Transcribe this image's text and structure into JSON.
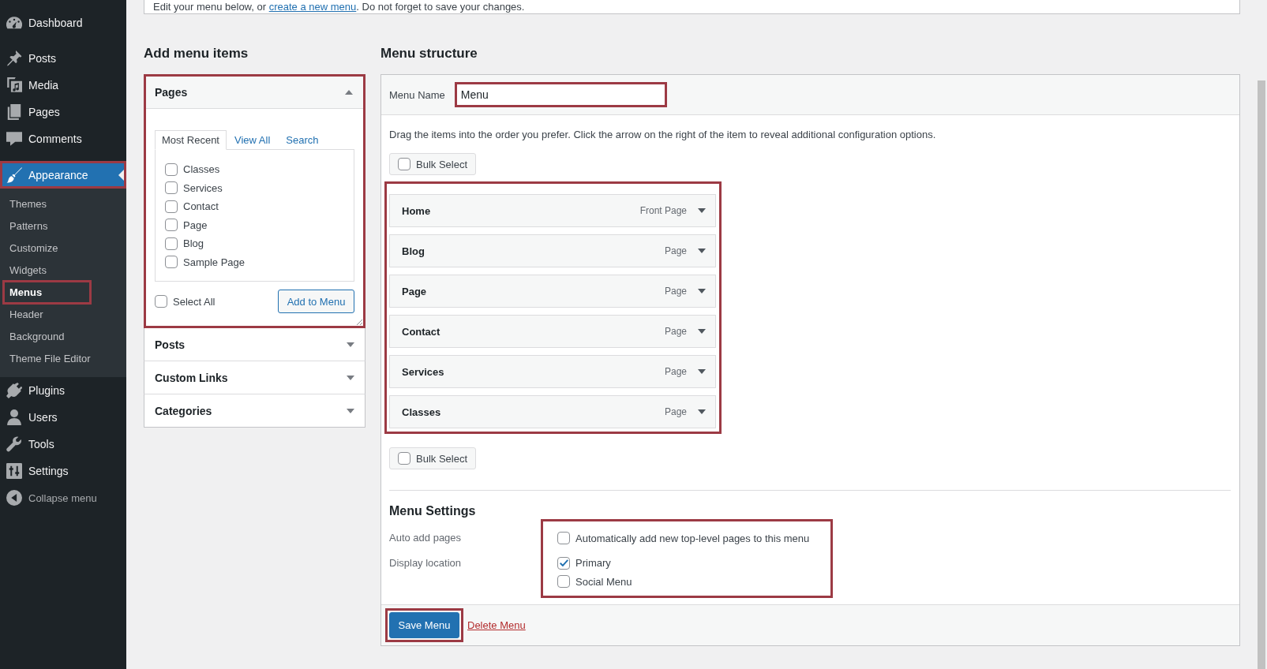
{
  "sidebar": {
    "groups": [
      [
        {
          "label": "Dashboard",
          "current": false,
          "highlighted": false
        }
      ],
      [
        {
          "label": "Posts",
          "current": false,
          "highlighted": false
        },
        {
          "label": "Media",
          "current": false,
          "highlighted": false
        },
        {
          "label": "Pages",
          "current": false,
          "highlighted": false
        },
        {
          "label": "Comments",
          "current": false,
          "highlighted": false
        }
      ],
      [
        {
          "label": "Appearance",
          "current": true,
          "highlighted": true,
          "submenu": [
            {
              "label": "Themes",
              "selected": false,
              "highlighted": false
            },
            {
              "label": "Patterns",
              "selected": false,
              "highlighted": false
            },
            {
              "label": "Customize",
              "selected": false,
              "highlighted": false
            },
            {
              "label": "Widgets",
              "selected": false,
              "highlighted": false
            },
            {
              "label": "Menus",
              "selected": true,
              "highlighted": true
            },
            {
              "label": "Header",
              "selected": false,
              "highlighted": false
            },
            {
              "label": "Background",
              "selected": false,
              "highlighted": false
            },
            {
              "label": "Theme File Editor",
              "selected": false,
              "highlighted": false
            }
          ]
        },
        {
          "label": "Plugins",
          "current": false,
          "highlighted": false
        },
        {
          "label": "Users",
          "current": false,
          "highlighted": false
        },
        {
          "label": "Tools",
          "current": false,
          "highlighted": false
        },
        {
          "label": "Settings",
          "current": false,
          "highlighted": false
        }
      ]
    ],
    "collapse_label": "Collapse menu"
  },
  "notice": {
    "text_before": "Edit your menu below, or ",
    "link": "create a new menu",
    "text_after": ". Do not forget to save your changes."
  },
  "add_menu_items": {
    "title": "Add menu items",
    "sections": [
      {
        "title": "Pages",
        "expanded": true,
        "highlighted": true,
        "tabs": [
          {
            "label": "Most Recent",
            "selected": true
          },
          {
            "label": "View All",
            "selected": false
          },
          {
            "label": "Search",
            "selected": false
          }
        ],
        "items": [
          {
            "label": "Classes",
            "checked": false
          },
          {
            "label": "Services",
            "checked": false
          },
          {
            "label": "Contact",
            "checked": false
          },
          {
            "label": "Page",
            "checked": false
          },
          {
            "label": "Blog",
            "checked": false
          },
          {
            "label": "Sample Page",
            "checked": false
          }
        ],
        "select_all": {
          "label": "Select All",
          "checked": false
        },
        "button": "Add to Menu"
      },
      {
        "title": "Posts",
        "expanded": false,
        "highlighted": false
      },
      {
        "title": "Custom Links",
        "expanded": false,
        "highlighted": false
      },
      {
        "title": "Categories",
        "expanded": false,
        "highlighted": false
      }
    ]
  },
  "menu_structure": {
    "title": "Menu structure",
    "menu_name": {
      "label": "Menu Name",
      "value": "Menu",
      "highlighted": true
    },
    "instructions": "Drag the items into the order you prefer. Click the arrow on the right of the item to reveal additional configuration options.",
    "bulk_select_top": {
      "label": "Bulk Select",
      "checked": false
    },
    "menu_items": {
      "highlighted": true,
      "items": [
        {
          "title": "Home",
          "type": "Front Page"
        },
        {
          "title": "Blog",
          "type": "Page"
        },
        {
          "title": "Page",
          "type": "Page"
        },
        {
          "title": "Contact",
          "type": "Page"
        },
        {
          "title": "Services",
          "type": "Page"
        },
        {
          "title": "Classes",
          "type": "Page"
        }
      ]
    },
    "bulk_select_bottom": {
      "label": "Bulk Select",
      "checked": false
    },
    "settings": {
      "title": "Menu Settings",
      "highlighted": true,
      "auto_add": {
        "label": "Auto add pages",
        "option": {
          "label": "Automatically add new top-level pages to this menu",
          "checked": false
        }
      },
      "display_location": {
        "label": "Display location",
        "options": [
          {
            "label": "Primary",
            "checked": true
          },
          {
            "label": "Social Menu",
            "checked": false
          }
        ]
      }
    },
    "save_button": {
      "label": "Save Menu",
      "highlighted": true
    },
    "delete_link": "Delete Menu"
  }
}
